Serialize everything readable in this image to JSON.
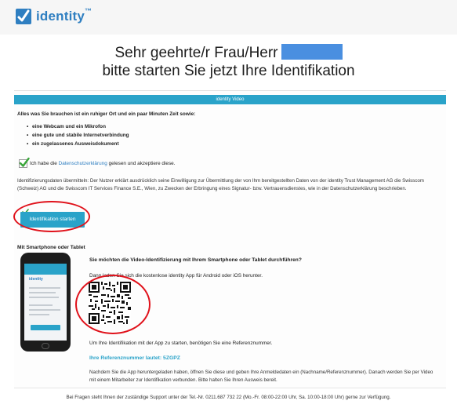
{
  "header": {
    "logo_text": "identity",
    "logo_tm": "™",
    "brand_color": "#2f7fc1",
    "icon": "check-mark-icon"
  },
  "greeting": {
    "line1": "Sehr geehrte/r Frau/Herr",
    "line2": "bitte starten Sie jetzt Ihre Identifikation"
  },
  "panel": {
    "bar_title": "identity Video",
    "accent_color": "#2aa3c9",
    "intro": "Alles was Sie brauchen ist ein ruhiger Ort und ein paar Minuten Zeit sowie:",
    "requirements": [
      "eine Webcam und ein Mikrofon",
      "eine gute und stabile Internetverbindung",
      "ein zugelassenes Ausweisdokument"
    ],
    "consent": {
      "checked": true,
      "prefix": "Ich habe die",
      "link": "Datenschutzerklärung",
      "suffix": "gelesen und akzeptiere diese."
    },
    "legal_text": "Identifizierungsdaten übermitteln: Der Nutzer erklärt ausdrücklich seine Einwilligung zur Übermittlung der von Ihm bereitgestellten Daten von der identity Trust Management AG die Swisscom (Schweiz) AG und die Swisscom IT Services Finance S.E., Wien, zu Zwecken der Erbringung eines Signatur- bzw. Vertrauensdienstes, wie in der Datenschutzerklärung beschrieben.",
    "start_button": "Identifikation starten"
  },
  "mobile": {
    "section_title": "Mit Smartphone oder Tablet",
    "question": "Sie möchten die Video-Identifizierung mit Ihrem Smartphone oder Tablet durchführen?",
    "download_text": "Dann laden Sie sich die kostenlose identity App für Android oder iOS herunter.",
    "start_text": "Um Ihre Identifikation mit der App zu starten, benötigen Sie eine Referenznummer.",
    "reference_label": "Ihre Referenznummer lautet: 5ZGPZ",
    "after_text": "Nachdem Sie die App heruntergeladen haben, öffnen Sie diese und geben Ihre Anmeldedaten ein (Nachname/Referenznummer). Danach werden Sie per Video mit einem Mitarbeiter zur Identifikation verbunden. Bitte halten Sie Ihren Ausweis bereit."
  },
  "footer": {
    "text": "Bei Fragen steht Ihnen der zuständige Support unter der Tel.-Nr. 0211.687 732 22 (Mo.-Fr. 08:00-22:00 Uhr, Sa. 10:00-18:00 Uhr) gerne zur Verfügung."
  },
  "highlight_color": "#e0121b"
}
